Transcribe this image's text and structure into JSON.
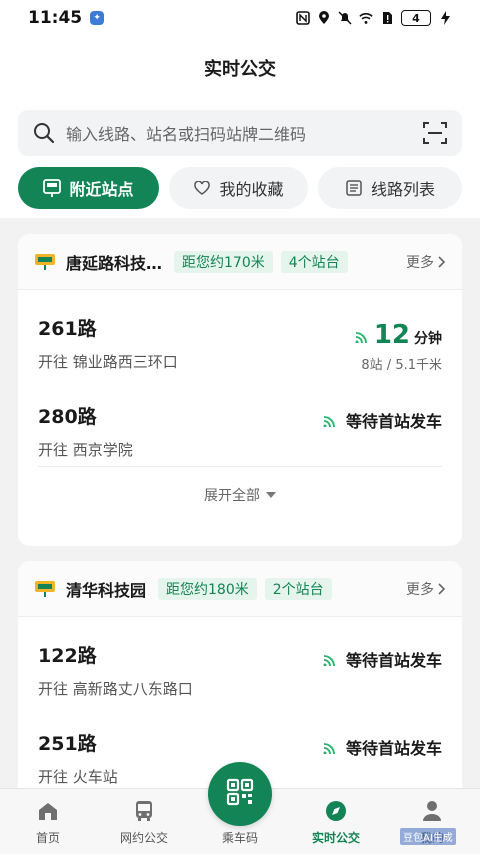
{
  "status": {
    "time": "11:45",
    "battery": "4"
  },
  "header": {
    "title": "实时公交"
  },
  "search": {
    "placeholder": "输入线路、站名或扫码站牌二维码"
  },
  "tabs": [
    {
      "label": "附近站点",
      "icon": "stop-sign-icon",
      "active": true
    },
    {
      "label": "我的收藏",
      "icon": "heart-icon",
      "active": false
    },
    {
      "label": "线路列表",
      "icon": "list-icon",
      "active": false
    }
  ],
  "stops": [
    {
      "name": "唐延路科技…",
      "distance": "距您约170米",
      "count": "4个站台",
      "more": "更多",
      "routes": [
        {
          "number": "261路",
          "direction": "开往 锦业路西三环口",
          "eta_value": "12",
          "eta_unit": "分钟",
          "eta_detail": "8站 / 5.1千米"
        },
        {
          "number": "280路",
          "direction": "开往 西京学院",
          "status": "等待首站发车"
        }
      ],
      "expand": "展开全部"
    },
    {
      "name": "清华科技园",
      "distance": "距您约180米",
      "count": "2个站台",
      "more": "更多",
      "routes": [
        {
          "number": "122路",
          "direction": "开往 高新路丈八东路口",
          "status": "等待首站发车"
        },
        {
          "number": "251路",
          "direction": "开往 火车站",
          "status": "等待首站发车"
        }
      ]
    }
  ],
  "nav": [
    {
      "label": "首页",
      "icon": "home-icon"
    },
    {
      "label": "网约公交",
      "icon": "bus-icon"
    },
    {
      "label": "乘车码",
      "icon": "qr-code-icon"
    },
    {
      "label": "实时公交",
      "icon": "compass-icon",
      "active": true
    },
    {
      "label": "我的",
      "icon": "user-icon"
    }
  ],
  "watermark": "豆包AI生成",
  "colors": {
    "accent": "#128456",
    "pill_bg": "#e5f4ec"
  }
}
